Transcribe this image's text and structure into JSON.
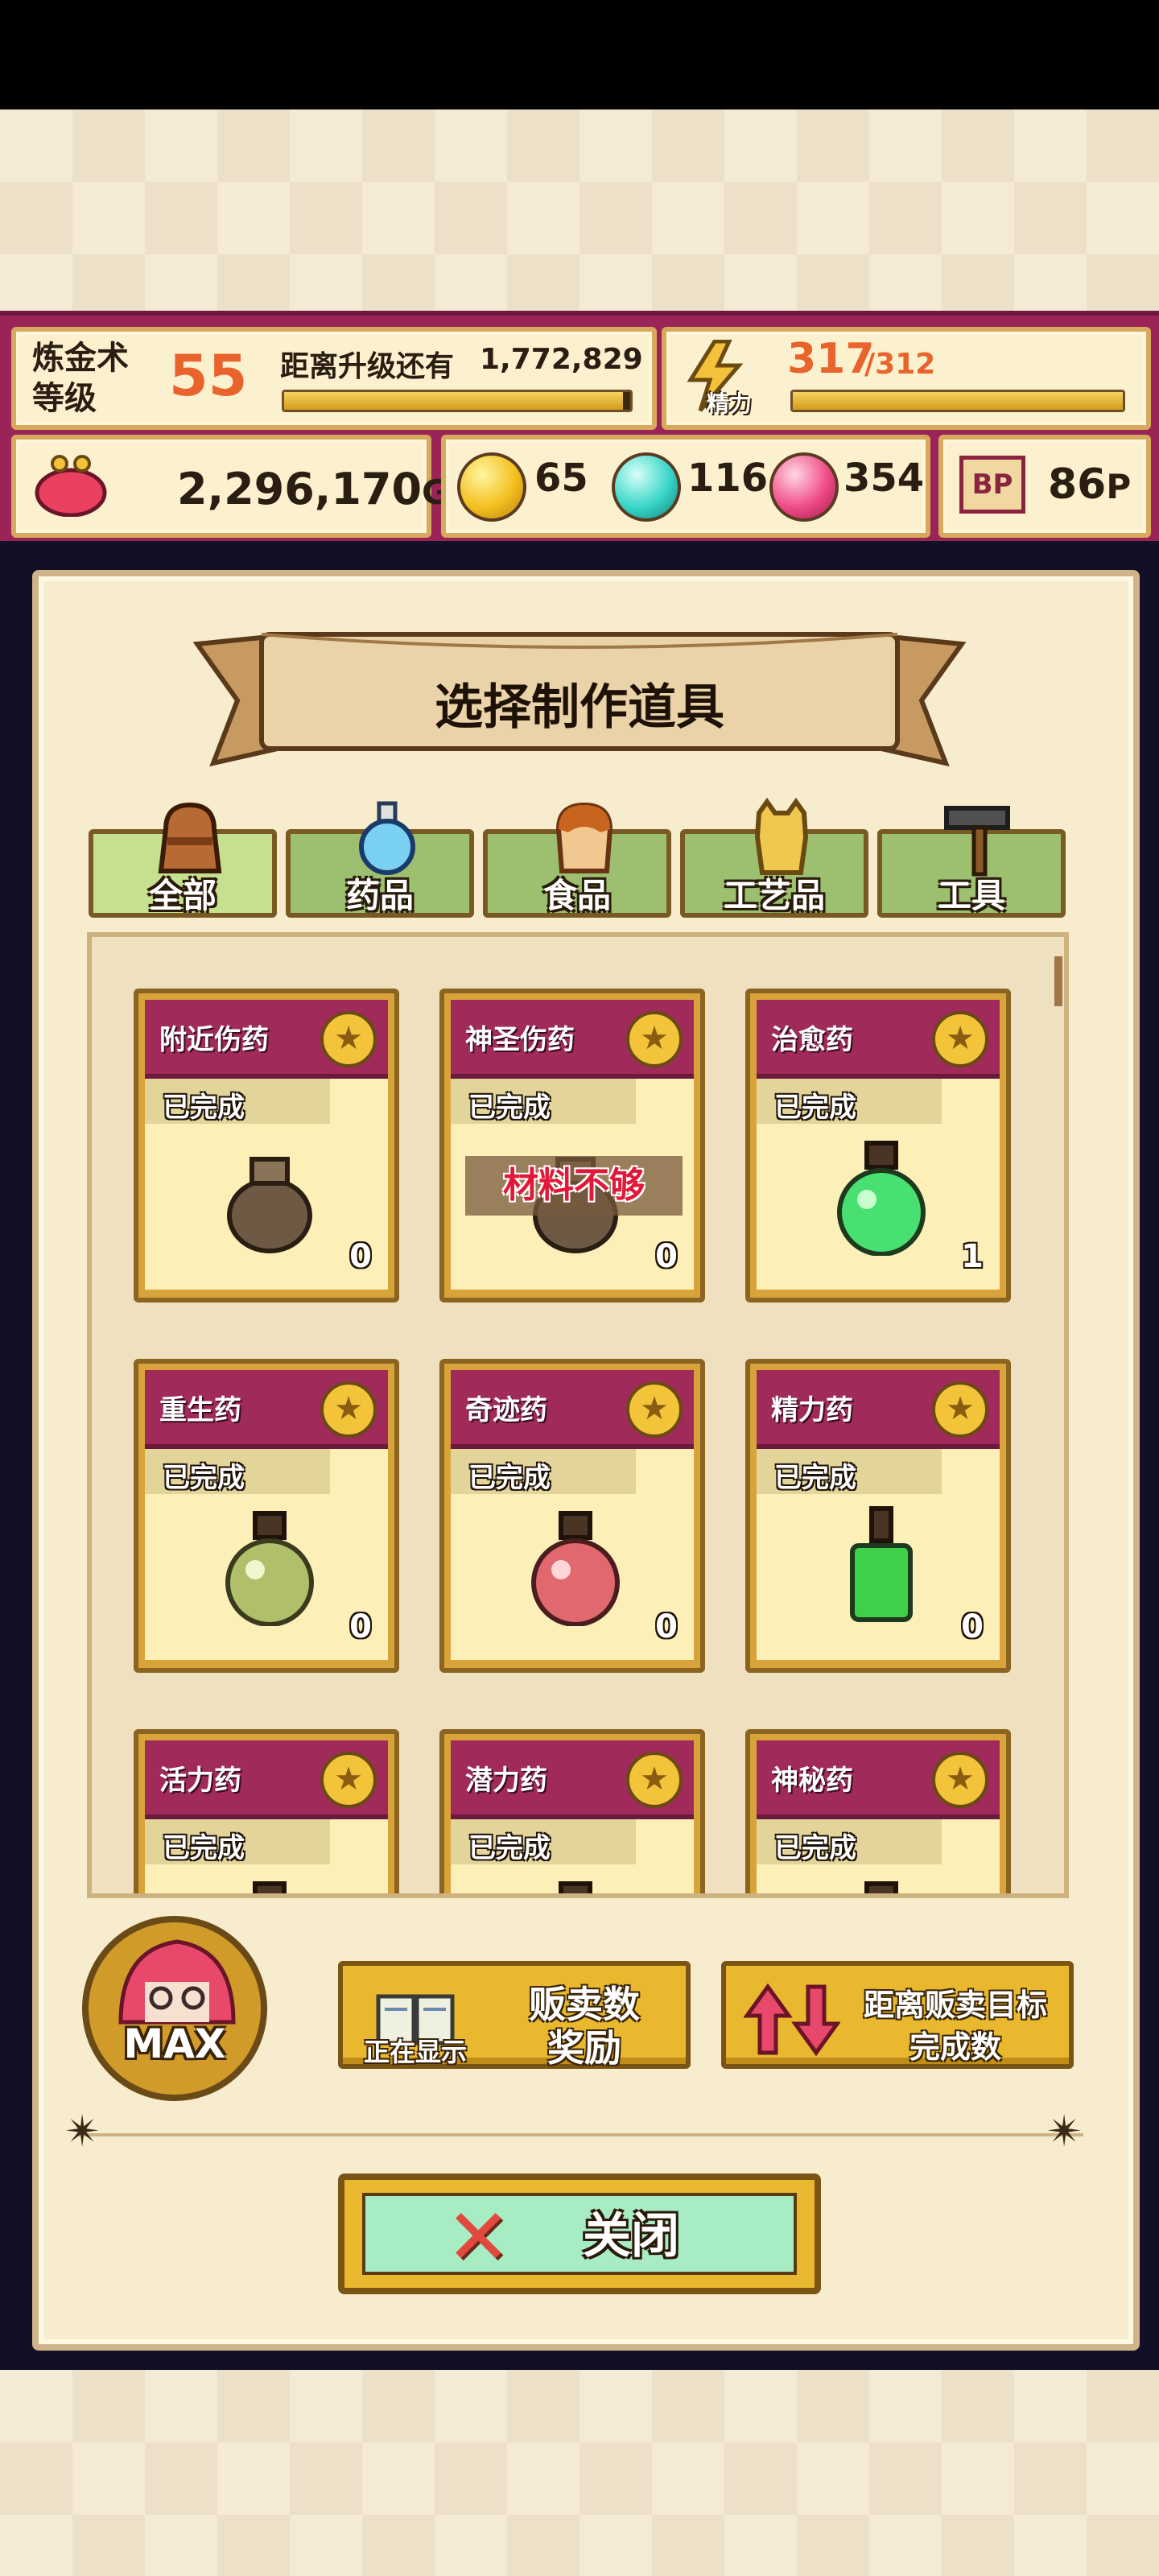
{
  "hud": {
    "level_label": "炼金术\n等级",
    "level_value": "55",
    "next_level_label": "距离升级还有",
    "next_level_value": "1,772,829",
    "level_progress": 0.98,
    "energy_label": "精力",
    "energy_current": "317",
    "energy_max": "/312",
    "energy_progress": 1.0,
    "gold_value": "2,296,170",
    "gold_unit": "G",
    "yellow_orb_count": "65",
    "blue_orb_count": "116",
    "pink_orb_count": "354",
    "bp_icon_text": "BP",
    "bp_value": "86",
    "bp_unit": "P"
  },
  "panel": {
    "title": "选择制作道具"
  },
  "tabs": [
    {
      "label": "全部",
      "icon": "bag-icon",
      "active": true
    },
    {
      "label": "药品",
      "icon": "potion-icon",
      "active": false
    },
    {
      "label": "食品",
      "icon": "bread-icon",
      "active": false
    },
    {
      "label": "工艺品",
      "icon": "cat-figurine-icon",
      "active": false
    },
    {
      "label": "工具",
      "icon": "hammer-icon",
      "active": false
    }
  ],
  "items": [
    {
      "name": "附近伤药",
      "status": "已完成",
      "count": "0",
      "icon": "pouch-icon"
    },
    {
      "name": "神圣伤药",
      "status": "已完成",
      "count": "0",
      "icon": "pouch-icon",
      "overlay": "材料不够"
    },
    {
      "name": "治愈药",
      "status": "已完成",
      "count": "1",
      "icon": "green-potion-icon"
    },
    {
      "name": "重生药",
      "status": "已完成",
      "count": "0",
      "icon": "olive-potion-icon"
    },
    {
      "name": "奇迹药",
      "status": "已完成",
      "count": "0",
      "icon": "red-potion-icon"
    },
    {
      "name": "精力药",
      "status": "已完成",
      "count": "0",
      "icon": "green-bottle-icon"
    },
    {
      "name": "活力药",
      "status": "已完成",
      "count": "",
      "icon": "potion-icon"
    },
    {
      "name": "潜力药",
      "status": "已完成",
      "count": "",
      "icon": "potion-icon"
    },
    {
      "name": "神秘药",
      "status": "已完成",
      "count": "",
      "icon": "potion-icon"
    }
  ],
  "controls": {
    "max_label": "MAX",
    "sales_reward_now_showing": "正在显示",
    "sales_reward_label_1": "贩卖数",
    "sales_reward_label_2": "奖励",
    "sort_label_1": "距离贩卖目标",
    "sort_label_2": "完成数",
    "close_label": "关闭"
  },
  "colors": {
    "hud_bg": "#9a2457",
    "card_header": "#a02a5a",
    "level_number": "#e8642c",
    "close_button_bg": "#a8ecc4"
  }
}
